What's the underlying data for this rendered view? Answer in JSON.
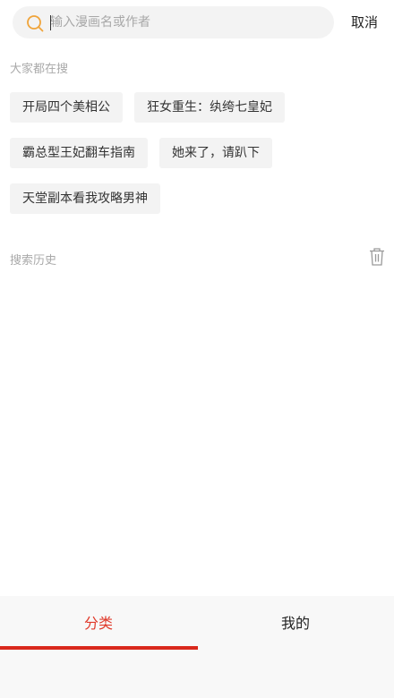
{
  "search": {
    "placeholder": "输入漫画名或作者",
    "cancel_label": "取消"
  },
  "hot": {
    "title": "大家都在搜",
    "tags": [
      "开局四个美相公",
      "狂女重生：纨绔七皇妃",
      "霸总型王妃翻车指南",
      "她来了，请趴下",
      "天堂副本看我攻略男神"
    ]
  },
  "history": {
    "title": "搜索历史"
  },
  "tabs": [
    {
      "label": "分类",
      "active": true
    },
    {
      "label": "我的",
      "active": false
    }
  ],
  "colors": {
    "accent": "#d9281c",
    "active_tab_text": "#e03a2b",
    "search_icon": "#f0a43a"
  }
}
